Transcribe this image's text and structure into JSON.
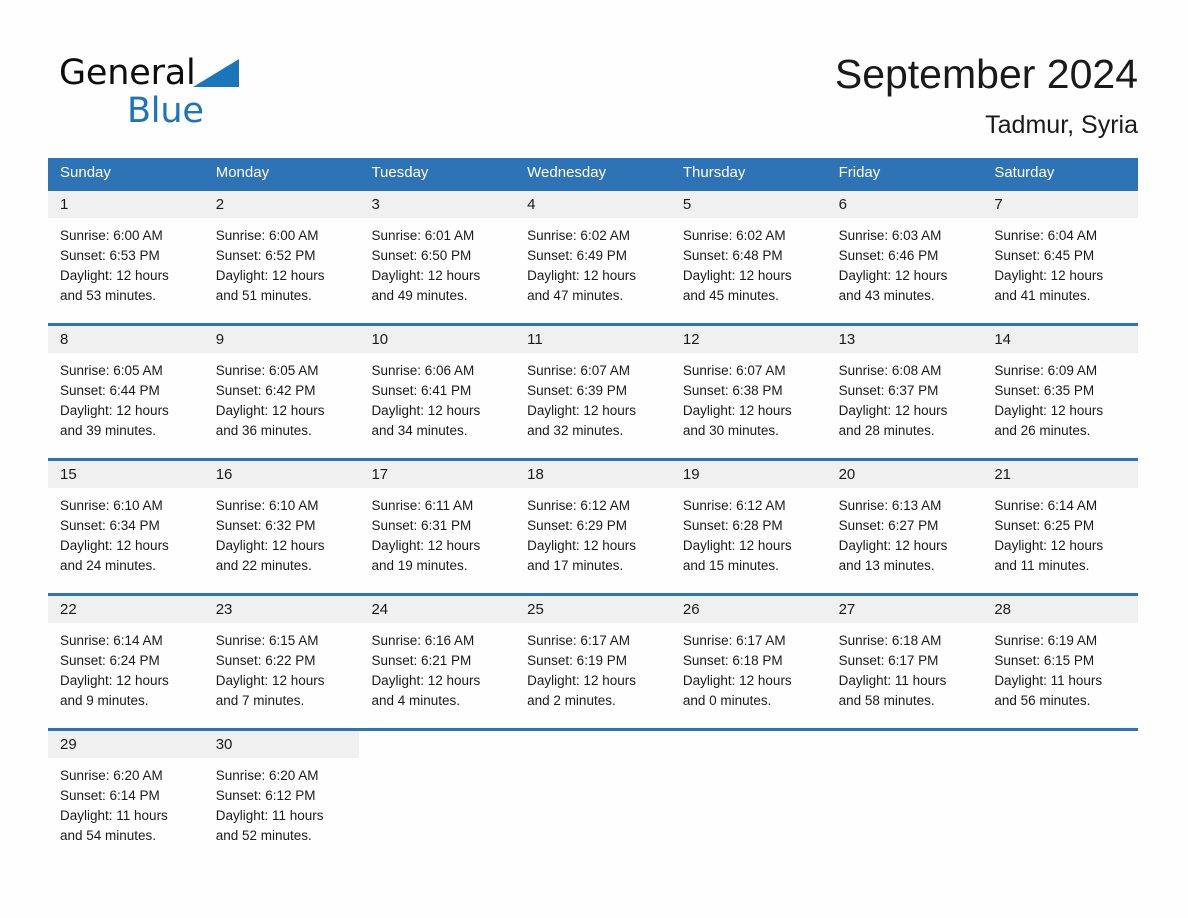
{
  "brand": {
    "name_part1": "General",
    "name_part2": "Blue",
    "triangle_color": "#1b75bb"
  },
  "header": {
    "title": "September 2024",
    "subtitle": "Tadmur, Syria"
  },
  "theme": {
    "header_blue": "#2e73b5",
    "date_band_gray": "#f0f0f0",
    "text_color": "#1a1a1a",
    "page_background": "#fefefe"
  },
  "calendar": {
    "weekdays": [
      "Sunday",
      "Monday",
      "Tuesday",
      "Wednesday",
      "Thursday",
      "Friday",
      "Saturday"
    ],
    "weeks": [
      [
        {
          "date": "1",
          "sunrise": "Sunrise: 6:00 AM",
          "sunset": "Sunset: 6:53 PM",
          "daylight": "Daylight: 12 hours and 53 minutes."
        },
        {
          "date": "2",
          "sunrise": "Sunrise: 6:00 AM",
          "sunset": "Sunset: 6:52 PM",
          "daylight": "Daylight: 12 hours and 51 minutes."
        },
        {
          "date": "3",
          "sunrise": "Sunrise: 6:01 AM",
          "sunset": "Sunset: 6:50 PM",
          "daylight": "Daylight: 12 hours and 49 minutes."
        },
        {
          "date": "4",
          "sunrise": "Sunrise: 6:02 AM",
          "sunset": "Sunset: 6:49 PM",
          "daylight": "Daylight: 12 hours and 47 minutes."
        },
        {
          "date": "5",
          "sunrise": "Sunrise: 6:02 AM",
          "sunset": "Sunset: 6:48 PM",
          "daylight": "Daylight: 12 hours and 45 minutes."
        },
        {
          "date": "6",
          "sunrise": "Sunrise: 6:03 AM",
          "sunset": "Sunset: 6:46 PM",
          "daylight": "Daylight: 12 hours and 43 minutes."
        },
        {
          "date": "7",
          "sunrise": "Sunrise: 6:04 AM",
          "sunset": "Sunset: 6:45 PM",
          "daylight": "Daylight: 12 hours and 41 minutes."
        }
      ],
      [
        {
          "date": "8",
          "sunrise": "Sunrise: 6:05 AM",
          "sunset": "Sunset: 6:44 PM",
          "daylight": "Daylight: 12 hours and 39 minutes."
        },
        {
          "date": "9",
          "sunrise": "Sunrise: 6:05 AM",
          "sunset": "Sunset: 6:42 PM",
          "daylight": "Daylight: 12 hours and 36 minutes."
        },
        {
          "date": "10",
          "sunrise": "Sunrise: 6:06 AM",
          "sunset": "Sunset: 6:41 PM",
          "daylight": "Daylight: 12 hours and 34 minutes."
        },
        {
          "date": "11",
          "sunrise": "Sunrise: 6:07 AM",
          "sunset": "Sunset: 6:39 PM",
          "daylight": "Daylight: 12 hours and 32 minutes."
        },
        {
          "date": "12",
          "sunrise": "Sunrise: 6:07 AM",
          "sunset": "Sunset: 6:38 PM",
          "daylight": "Daylight: 12 hours and 30 minutes."
        },
        {
          "date": "13",
          "sunrise": "Sunrise: 6:08 AM",
          "sunset": "Sunset: 6:37 PM",
          "daylight": "Daylight: 12 hours and 28 minutes."
        },
        {
          "date": "14",
          "sunrise": "Sunrise: 6:09 AM",
          "sunset": "Sunset: 6:35 PM",
          "daylight": "Daylight: 12 hours and 26 minutes."
        }
      ],
      [
        {
          "date": "15",
          "sunrise": "Sunrise: 6:10 AM",
          "sunset": "Sunset: 6:34 PM",
          "daylight": "Daylight: 12 hours and 24 minutes."
        },
        {
          "date": "16",
          "sunrise": "Sunrise: 6:10 AM",
          "sunset": "Sunset: 6:32 PM",
          "daylight": "Daylight: 12 hours and 22 minutes."
        },
        {
          "date": "17",
          "sunrise": "Sunrise: 6:11 AM",
          "sunset": "Sunset: 6:31 PM",
          "daylight": "Daylight: 12 hours and 19 minutes."
        },
        {
          "date": "18",
          "sunrise": "Sunrise: 6:12 AM",
          "sunset": "Sunset: 6:29 PM",
          "daylight": "Daylight: 12 hours and 17 minutes."
        },
        {
          "date": "19",
          "sunrise": "Sunrise: 6:12 AM",
          "sunset": "Sunset: 6:28 PM",
          "daylight": "Daylight: 12 hours and 15 minutes."
        },
        {
          "date": "20",
          "sunrise": "Sunrise: 6:13 AM",
          "sunset": "Sunset: 6:27 PM",
          "daylight": "Daylight: 12 hours and 13 minutes."
        },
        {
          "date": "21",
          "sunrise": "Sunrise: 6:14 AM",
          "sunset": "Sunset: 6:25 PM",
          "daylight": "Daylight: 12 hours and 11 minutes."
        }
      ],
      [
        {
          "date": "22",
          "sunrise": "Sunrise: 6:14 AM",
          "sunset": "Sunset: 6:24 PM",
          "daylight": "Daylight: 12 hours and 9 minutes."
        },
        {
          "date": "23",
          "sunrise": "Sunrise: 6:15 AM",
          "sunset": "Sunset: 6:22 PM",
          "daylight": "Daylight: 12 hours and 7 minutes."
        },
        {
          "date": "24",
          "sunrise": "Sunrise: 6:16 AM",
          "sunset": "Sunset: 6:21 PM",
          "daylight": "Daylight: 12 hours and 4 minutes."
        },
        {
          "date": "25",
          "sunrise": "Sunrise: 6:17 AM",
          "sunset": "Sunset: 6:19 PM",
          "daylight": "Daylight: 12 hours and 2 minutes."
        },
        {
          "date": "26",
          "sunrise": "Sunrise: 6:17 AM",
          "sunset": "Sunset: 6:18 PM",
          "daylight": "Daylight: 12 hours and 0 minutes."
        },
        {
          "date": "27",
          "sunrise": "Sunrise: 6:18 AM",
          "sunset": "Sunset: 6:17 PM",
          "daylight": "Daylight: 11 hours and 58 minutes."
        },
        {
          "date": "28",
          "sunrise": "Sunrise: 6:19 AM",
          "sunset": "Sunset: 6:15 PM",
          "daylight": "Daylight: 11 hours and 56 minutes."
        }
      ],
      [
        {
          "date": "29",
          "sunrise": "Sunrise: 6:20 AM",
          "sunset": "Sunset: 6:14 PM",
          "daylight": "Daylight: 11 hours and 54 minutes."
        },
        {
          "date": "30",
          "sunrise": "Sunrise: 6:20 AM",
          "sunset": "Sunset: 6:12 PM",
          "daylight": "Daylight: 11 hours and 52 minutes."
        },
        {
          "date": "",
          "sunrise": "",
          "sunset": "",
          "daylight": ""
        },
        {
          "date": "",
          "sunrise": "",
          "sunset": "",
          "daylight": ""
        },
        {
          "date": "",
          "sunrise": "",
          "sunset": "",
          "daylight": ""
        },
        {
          "date": "",
          "sunrise": "",
          "sunset": "",
          "daylight": ""
        },
        {
          "date": "",
          "sunrise": "",
          "sunset": "",
          "daylight": ""
        }
      ]
    ]
  }
}
